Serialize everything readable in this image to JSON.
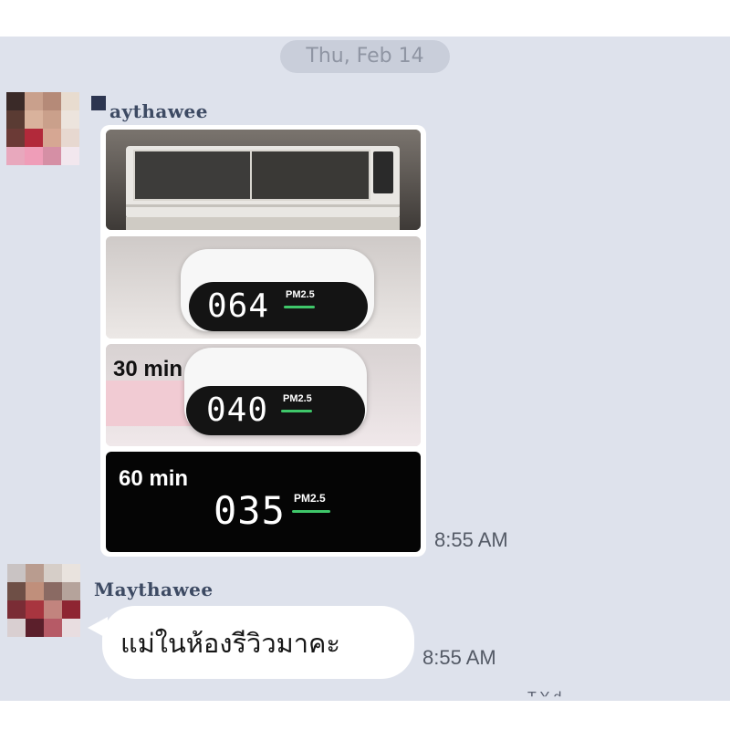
{
  "chat": {
    "date_separator": "Thu, Feb 14",
    "messages": [
      {
        "sender": "Maythawee",
        "sender_visible": "aythawee",
        "type": "photo",
        "time": "8:55 AM",
        "panels": [
          {
            "kind": "air-conditioner"
          },
          {
            "kind": "meter",
            "reading": "064",
            "label": "PM2.5",
            "caption": ""
          },
          {
            "kind": "meter",
            "reading": "040",
            "label": "PM2.5",
            "caption": "30 min"
          },
          {
            "kind": "meter-dark",
            "reading": "035",
            "label": "PM2.5",
            "caption": "60 min"
          }
        ]
      },
      {
        "sender": "Maythawee",
        "type": "text",
        "text": "แม่ในห้องรีวิวมาคะ",
        "time": "8:55 AM"
      }
    ],
    "bottom_hint": "T      Y      d"
  },
  "colors": {
    "chat_background": "#dee2ec",
    "date_pill": "#c9ceda",
    "bubble": "#ffffff",
    "pm_indicator": "#3fc76a"
  }
}
